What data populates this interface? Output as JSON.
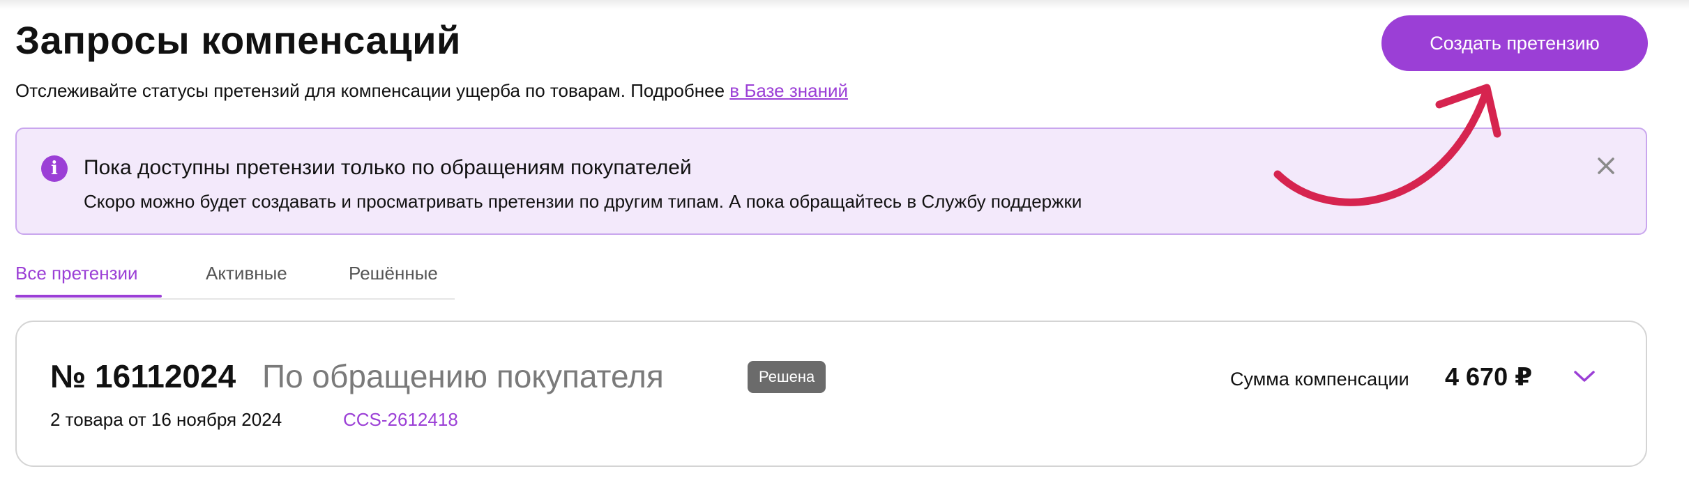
{
  "header": {
    "title": "Запросы компенсаций",
    "subtitle": "Отслеживайте статусы претензий для компенсации ущерба по товарам. Подробнее ",
    "subtitle_link": "в Базе знаний",
    "create_button": "Создать претензию"
  },
  "banner": {
    "title": "Пока доступны претензии только по обращениям покупателей",
    "text": "Скоро можно будет создавать и просматривать претензии по другим типам. А пока обращайтесь в Службу поддержки",
    "info_icon": "info-icon",
    "close_icon": "close-icon"
  },
  "tabs": [
    {
      "label": "Все претензии",
      "active": true
    },
    {
      "label": "Активные",
      "active": false
    },
    {
      "label": "Решённые",
      "active": false
    }
  ],
  "claims": [
    {
      "number": "№ 16112024",
      "type": "По обращению покупателя",
      "status": "Решена",
      "date": "2 товара от 16 ноября 2024",
      "code": "CCS-2612418",
      "sum_label": "Сумма компенсации",
      "sum_value": "4 670 ₽",
      "expand_icon": "chevron-down-icon"
    }
  ],
  "colors": {
    "accent": "#9b3fd6",
    "banner_bg": "#f3e9fb",
    "banner_border": "#c9a6ee",
    "status_badge": "#6b6b6b",
    "annotation_arrow": "#d6244f"
  }
}
